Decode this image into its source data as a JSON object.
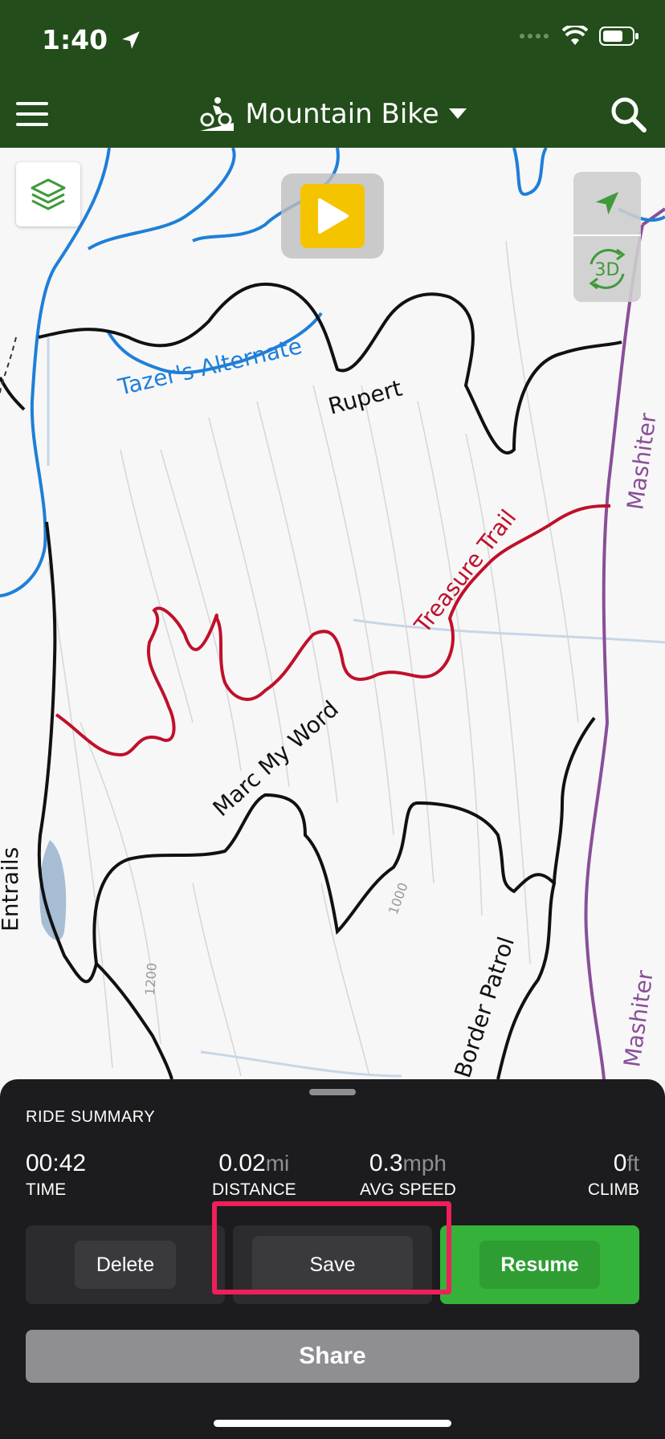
{
  "status": {
    "time": "1:40"
  },
  "header": {
    "title": "Mountain Bike"
  },
  "map": {
    "labels": {
      "tazers": "Tazer's Alternate",
      "rupert": "Rupert",
      "treasure": "Treasure Trail",
      "mashiter": "Mashiter",
      "marc": "Marc My Word",
      "entrails": "Entrails",
      "border": "Border Patrol",
      "mashiter2": "Mashiter",
      "c1000": "1000",
      "c1200": "1200"
    },
    "toggle_3d": "3D"
  },
  "colors": {
    "header_bg": "#234d1a",
    "trail_blue": "#1e7fd8",
    "trail_red": "#c0102a",
    "trail_black": "#111111",
    "trail_purple": "#8a4f98",
    "resume_green": "#35b23a",
    "highlight": "#f01f5a"
  },
  "summary": {
    "title": "RIDE SUMMARY",
    "time": {
      "value": "00:42",
      "label": "TIME"
    },
    "distance": {
      "value": "0.02",
      "unit": "mi",
      "label": "DISTANCE"
    },
    "speed": {
      "value": "0.3",
      "unit": "mph",
      "label": "AVG SPEED"
    },
    "climb": {
      "value": "0",
      "unit": "ft",
      "label": "CLIMB"
    }
  },
  "actions": {
    "delete": "Delete",
    "save": "Save",
    "resume": "Resume",
    "share": "Share"
  },
  "icons": [
    "location-arrow-icon",
    "signal-dots-icon",
    "wifi-icon",
    "battery-icon",
    "menu-icon",
    "biker-icon",
    "caret-down-icon",
    "search-icon",
    "layers-icon",
    "play-icon",
    "locate-arrow-icon",
    "rotate-3d-icon"
  ]
}
